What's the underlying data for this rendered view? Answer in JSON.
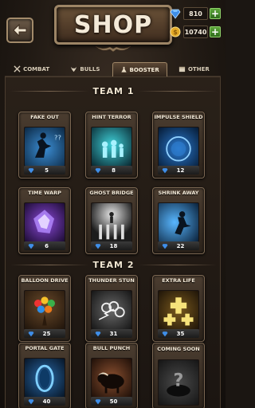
{
  "header": {
    "title": "SHOP",
    "gems": "810",
    "coins": "10740"
  },
  "tabs": [
    {
      "label": "COMBAT",
      "icon": "swords-icon",
      "active": false
    },
    {
      "label": "BULLS",
      "icon": "bull-icon",
      "active": false
    },
    {
      "label": "BOOSTER",
      "icon": "potion-icon",
      "active": true
    },
    {
      "label": "OTHER",
      "icon": "chest-icon",
      "active": false
    }
  ],
  "sections": [
    {
      "title": "TEAM 1",
      "items": [
        {
          "name": "FAKE OUT",
          "price": "5",
          "art": "#163a5a"
        },
        {
          "name": "HINT TERROR",
          "price": "8",
          "art": "#0f3f4f"
        },
        {
          "name": "IMPULSE SHIELD",
          "price": "12",
          "art": "#0b2d52"
        },
        {
          "name": "TIME WARP",
          "price": "6",
          "art": "#3a1c5a"
        },
        {
          "name": "GHOST BRIDGE",
          "price": "18",
          "art": "#2a2a2a"
        },
        {
          "name": "SHRINK AWAY",
          "price": "22",
          "art": "#123656"
        }
      ]
    },
    {
      "title": "TEAM 2",
      "items": [
        {
          "name": "BALLOON DRIVE",
          "price": "25",
          "art": "#3a2a18"
        },
        {
          "name": "THUNDER STUN",
          "price": "31",
          "art": "#2e2e2e"
        },
        {
          "name": "EXTRA LIFE",
          "price": "35",
          "art": "#3b2a10"
        },
        {
          "name": "PORTAL GATE",
          "price": "40",
          "art": "#102a44"
        },
        {
          "name": "BULL PUNCH",
          "price": "50",
          "art": "#3a1e12"
        },
        {
          "name": "COMING SOON",
          "price": "",
          "art": "#2a2a2a"
        }
      ]
    }
  ]
}
